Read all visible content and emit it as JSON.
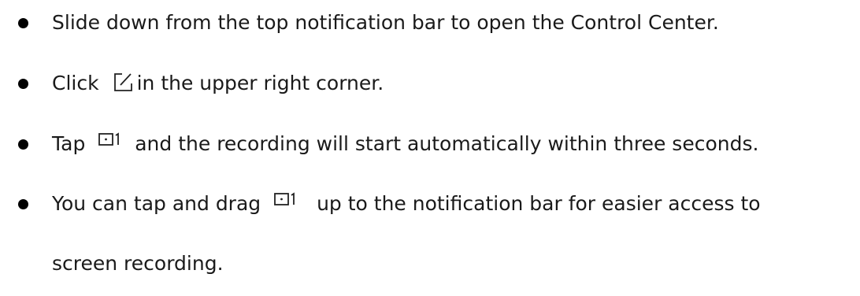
{
  "steps": [
    {
      "text": "Slide down from the top notification bar to open the Control Center."
    },
    {
      "before": "Click",
      "icon": "edit-square-icon",
      "after": "in the upper right corner."
    },
    {
      "before": "Tap",
      "icon": "screen-record-icon",
      "after": "and the recording will start automatically within three seconds."
    },
    {
      "before": "You can tap and drag",
      "icon": "screen-record-icon",
      "after": "up to the notification bar for easier access to",
      "continuation": "screen recording."
    }
  ]
}
